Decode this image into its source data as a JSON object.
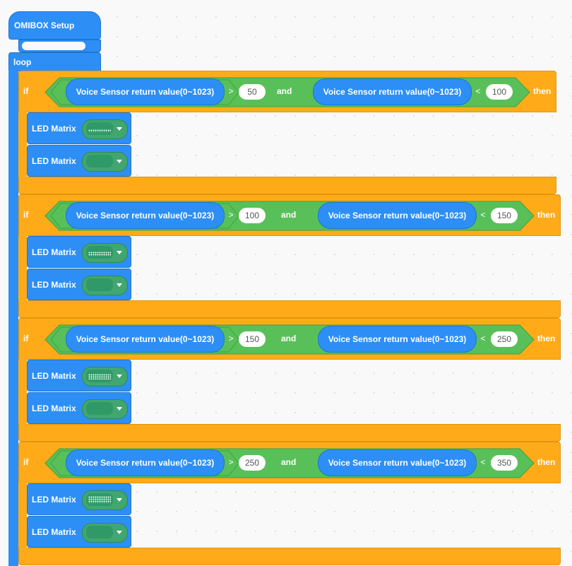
{
  "setup": {
    "label": "OMIBOX Setup"
  },
  "loop": {
    "label": "loop"
  },
  "keywords": {
    "if": "if",
    "and": "and",
    "then": "then",
    "led": "LED Matrix",
    "sensor": "Voice Sensor return value(0~1023)"
  },
  "blocks": [
    {
      "gt": {
        "op": ">",
        "value": "50"
      },
      "lt": {
        "op": "<",
        "value": "100"
      }
    },
    {
      "gt": {
        "op": ">",
        "value": "100"
      },
      "lt": {
        "op": "<",
        "value": "150"
      }
    },
    {
      "gt": {
        "op": ">",
        "value": "150"
      },
      "lt": {
        "op": "<",
        "value": "250"
      }
    },
    {
      "gt": {
        "op": ">",
        "value": "250"
      },
      "lt": {
        "op": "<",
        "value": "350"
      }
    }
  ],
  "colors": {
    "event": "#2d8ff5",
    "control": "#ffab19",
    "operator": "#59c059",
    "matrix": "#41a670"
  },
  "icons": {
    "matrix": "led-matrix-pattern-icon",
    "dropdown": "caret-down-icon"
  }
}
